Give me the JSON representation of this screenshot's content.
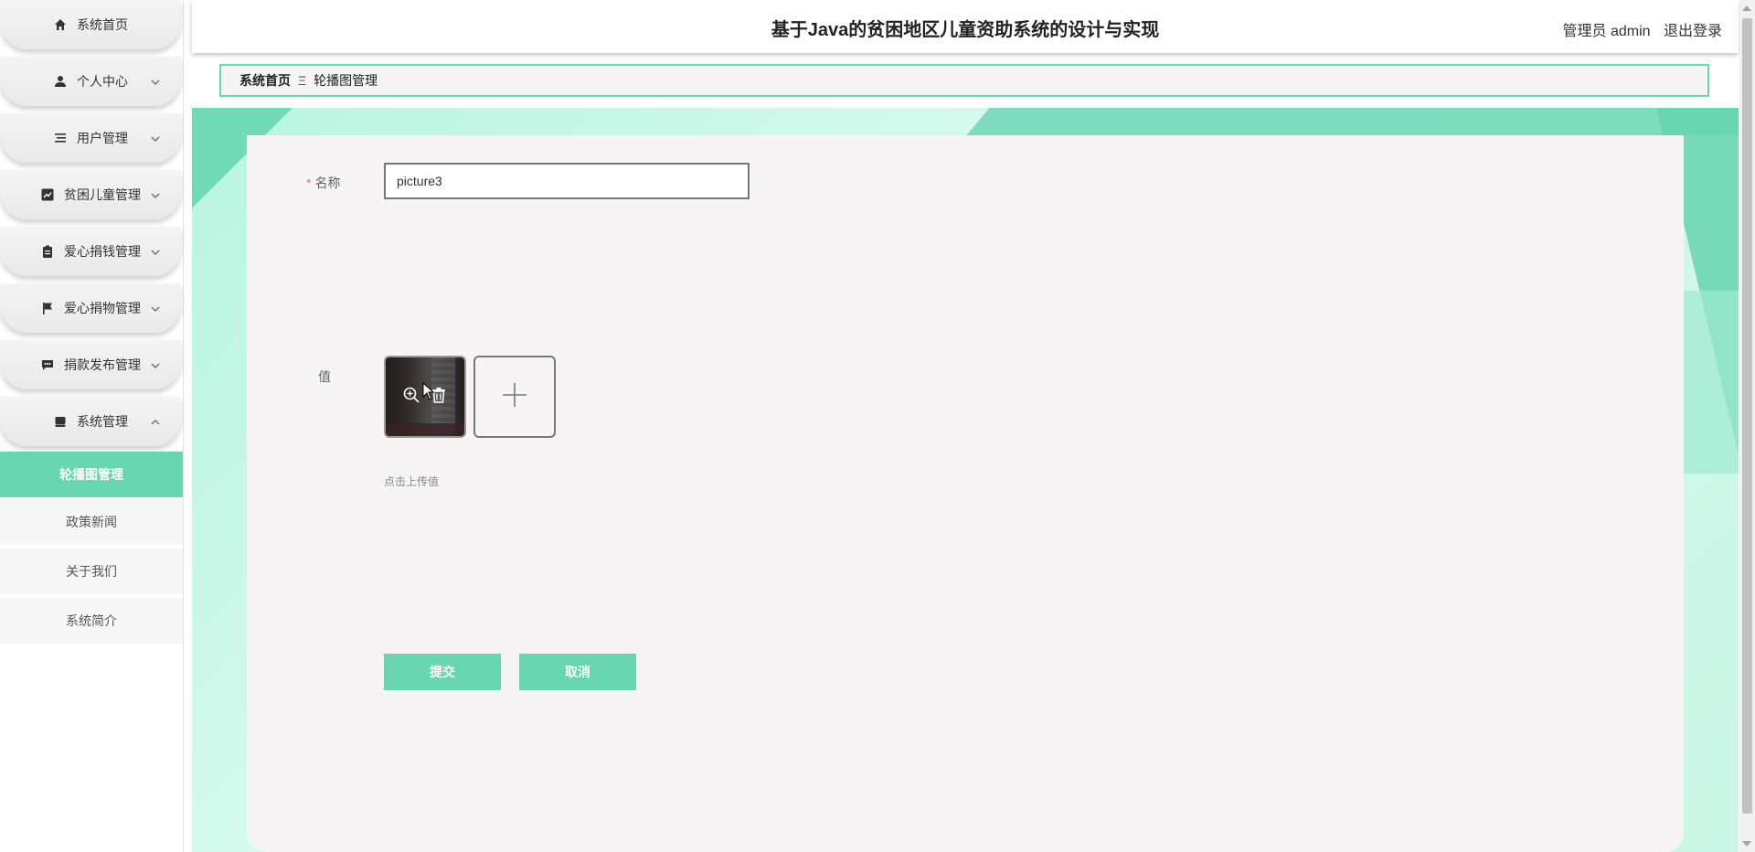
{
  "header": {
    "title": "基于Java的贫困地区儿童资助系统的设计与实现",
    "role": "管理员 admin",
    "logout": "退出登录"
  },
  "sidebar": {
    "items": [
      {
        "label": "系统首页",
        "icon": "home-icon"
      },
      {
        "label": "个人中心",
        "icon": "user-icon"
      },
      {
        "label": "用户管理",
        "icon": "list-icon"
      },
      {
        "label": "贫困儿童管理",
        "icon": "chart-icon"
      },
      {
        "label": "爱心捐钱管理",
        "icon": "clipboard-icon"
      },
      {
        "label": "爱心捐物管理",
        "icon": "flag-icon"
      },
      {
        "label": "捐款发布管理",
        "icon": "message-icon"
      },
      {
        "label": "系统管理",
        "icon": "drive-icon"
      }
    ],
    "sub_items": [
      {
        "label": "轮播图管理",
        "active": true
      },
      {
        "label": "政策新闻",
        "active": false
      },
      {
        "label": "关于我们",
        "active": false
      },
      {
        "label": "系统简介",
        "active": false
      }
    ]
  },
  "breadcrumb": {
    "home": "系统首页",
    "separator": "Ξ",
    "current": "轮播图管理"
  },
  "form": {
    "name_label": "名称",
    "name_value": "picture3",
    "value_label": "值",
    "upload_tip": "点击上传值",
    "submit": "提交",
    "cancel": "取消"
  },
  "colors": {
    "accent": "#66d5b0",
    "card": "#f6f4f5"
  }
}
